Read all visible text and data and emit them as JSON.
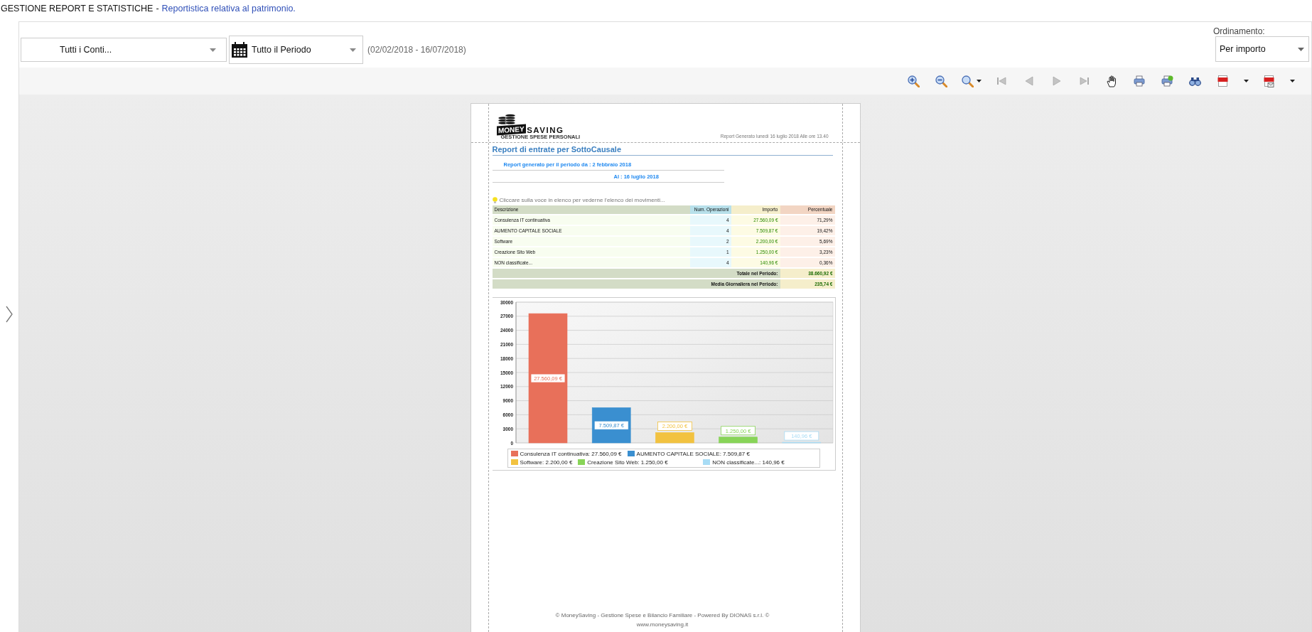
{
  "header": {
    "title": "GESTIONE REPORT E STATISTICHE",
    "separator": "-",
    "subtitle": "Reportistica relativa al patrimonio."
  },
  "filters": {
    "account": "Tutti i Conti...",
    "period": "Tutto il Periodo",
    "date_range": "(02/02/2018 - 16/07/2018)",
    "sort_label": "Ordinamento:",
    "sort": "Per importo"
  },
  "toolbar": [
    {
      "kind": "zoom-in"
    },
    {
      "kind": "zoom-out"
    },
    {
      "kind": "zoom-menu"
    },
    {
      "kind": "first"
    },
    {
      "kind": "prev"
    },
    {
      "kind": "next"
    },
    {
      "kind": "last"
    },
    {
      "kind": "hand"
    },
    {
      "kind": "print"
    },
    {
      "kind": "print-help"
    },
    {
      "kind": "find"
    },
    {
      "kind": "pdf"
    },
    {
      "kind": "caret"
    },
    {
      "kind": "pdf-mail"
    },
    {
      "kind": "caret"
    }
  ],
  "report": {
    "logo": {
      "word1": "MONEY",
      "word2": "SAVING",
      "tagline": "GESTIONE SPESE PERSONALI"
    },
    "generated": "Report Generato lunedì 16 luglio 2018 Alle ore 13.40",
    "title": "Report di entrate per SottoCausale",
    "period_from": "Report generato per il periodo da : 2 febbraio 2018",
    "period_to": "Al : 16 luglio 2018",
    "hint": "Cliccare sulla voce in elenco per vederne l'elenco dei movimenti...",
    "table": {
      "columns": [
        "Descrizione",
        "Num. Operazioni",
        "Importo",
        "Percentuale"
      ],
      "rows": [
        {
          "description": "Consulenza IT continuativa",
          "operations": "4",
          "amount": "27.560,09 €",
          "percentage": "71,29%"
        },
        {
          "description": "AUMENTO CAPITALE SOCIALE",
          "operations": "4",
          "amount": "7.509,87 €",
          "percentage": "19,42%"
        },
        {
          "description": "Software",
          "operations": "2",
          "amount": "2.200,00 €",
          "percentage": "5,69%"
        },
        {
          "description": "Creazione Sito Web",
          "operations": "1",
          "amount": "1.250,00 €",
          "percentage": "3,23%"
        },
        {
          "description": "NON classificate...",
          "operations": "4",
          "amount": "140,96 €",
          "percentage": "0,36%"
        }
      ],
      "totals": [
        {
          "label": "Totale nel Periodo:",
          "value": "38.660,92 €"
        },
        {
          "label": "Media Giornaliera nel Periodo:",
          "value": "235,74 €"
        }
      ]
    },
    "chart_data": {
      "type": "bar",
      "grid": true,
      "legend": "bottom",
      "ylim": [
        0,
        30000
      ],
      "yticks": [
        0,
        3000,
        6000,
        9000,
        12000,
        15000,
        18000,
        21000,
        24000,
        27000,
        30000
      ],
      "series": [
        {
          "name": "Consulenza IT continuativa: 27.560,09 €",
          "color": "#e8705a",
          "values": [
            27560
          ]
        },
        {
          "name": "AUMENTO CAPITALE SOCIALE: 7.509,87 €",
          "color": "#3a8fd0",
          "values": [
            7510
          ]
        },
        {
          "name": "Software: 2.200,00 €",
          "color": "#f2c240",
          "values": [
            2200
          ]
        },
        {
          "name": "Creazione Sito Web: 1.250,00 €",
          "color": "#88d458",
          "values": [
            1250
          ]
        },
        {
          "name": "NON classificate...: 140,96 €",
          "color": "#a8dcf5",
          "values": [
            140
          ]
        }
      ],
      "value_labels": [
        "27.560,09 €",
        "7.509,87 €",
        "2.200,00 €",
        "1.250,00 €",
        "140,96 €"
      ]
    },
    "footer": [
      "© MoneySaving - Gestione Spese e Bilancio Familiare - Powered By DIONAS s.r.l. ©",
      "www.moneysaving.it"
    ]
  }
}
